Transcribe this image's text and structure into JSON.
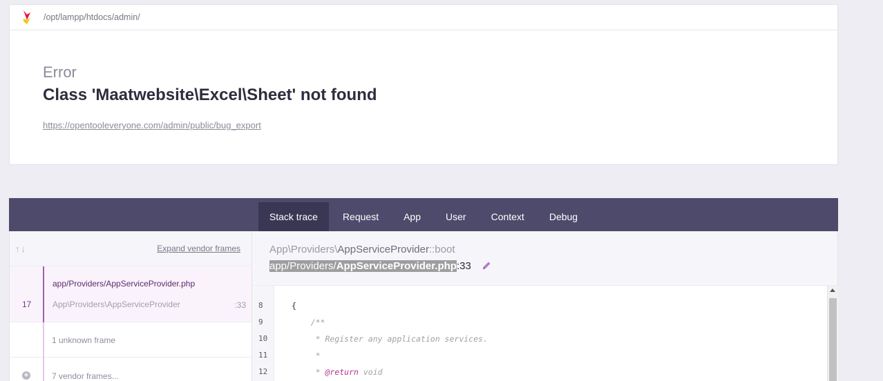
{
  "header": {
    "path": "/opt/lampp/htdocs/admin/"
  },
  "error": {
    "label": "Error",
    "message": "Class 'Maatwebsite\\Excel\\Sheet' not found",
    "url": "https://opentooleveryone.com/admin/public/bug_export"
  },
  "tabs": [
    {
      "label": "Stack trace",
      "active": true
    },
    {
      "label": "Request",
      "active": false
    },
    {
      "label": "App",
      "active": false
    },
    {
      "label": "User",
      "active": false
    },
    {
      "label": "Context",
      "active": false
    },
    {
      "label": "Debug",
      "active": false
    }
  ],
  "stack": {
    "arrows": "↑↓",
    "expand_label": "Expand vendor frames",
    "frames": [
      {
        "number": "17",
        "file": "app/Providers/AppServiceProvider.php",
        "class": "App\\Providers\\AppServiceProvider",
        "line": ":33"
      }
    ],
    "unknown_label": "1 unknown frame",
    "vendor_label": "7 vendor frames..."
  },
  "detail": {
    "namespace": "App\\Providers\\",
    "class": "AppServiceProvider",
    "method": "::boot",
    "file_dir": "app/Providers/",
    "file_name": "AppServiceProvider.php",
    "file_line": ":33"
  },
  "code": {
    "lines": [
      {
        "number": "8",
        "text": "{"
      },
      {
        "number": "9",
        "text": "    /**"
      },
      {
        "number": "10",
        "text": "     * Register any application services."
      },
      {
        "number": "11",
        "text": "     *"
      },
      {
        "number": "12",
        "text": "     * @return void"
      }
    ]
  },
  "colors": {
    "tabs_bg": "#4d4a6b",
    "tab_active_bg": "#3a3754",
    "accent": "#9b5fb0",
    "frame_active_bg": "#fbf3fc"
  }
}
